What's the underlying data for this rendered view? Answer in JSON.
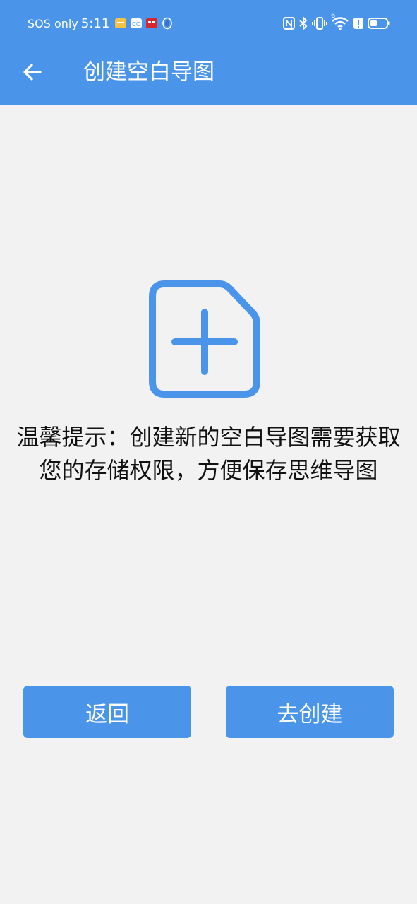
{
  "status_bar": {
    "carrier": "SOS only",
    "time": "5:11",
    "notification_icons": [
      "notes-icon",
      "cc-icon",
      "app-icon",
      "shield-icon"
    ],
    "system_icons": [
      "nfc-icon",
      "bluetooth-icon",
      "vibrate-icon",
      "wifi-icon",
      "alert-icon",
      "battery-icon"
    ],
    "wifi_label": "6"
  },
  "appbar": {
    "title": "创建空白导图",
    "back_icon": "arrow-left-icon"
  },
  "content": {
    "icon": "add-file-icon",
    "hint": "温馨提示：创建新的空白导图需要获取您的存储权限，方便保存思维导图"
  },
  "buttons": {
    "back_label": "返回",
    "create_label": "去创建"
  },
  "colors": {
    "primary": "#4a95ea",
    "background": "#f2f2f2",
    "text": "#111111"
  }
}
